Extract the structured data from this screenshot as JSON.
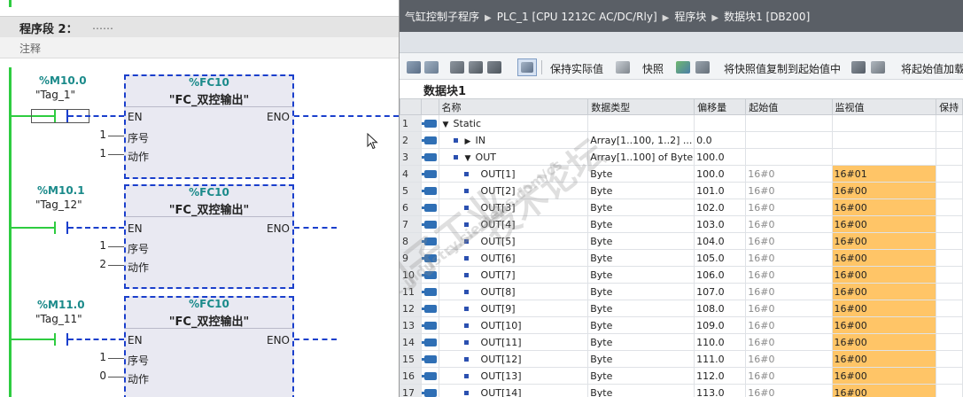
{
  "ladder": {
    "segment_title": "程序段 2：",
    "segment_dots": "……",
    "comment": "注释",
    "networks": [
      {
        "bit_addr": "%M10.0",
        "bit_tag": "\"Tag_1\"",
        "fc_addr": "%FC10",
        "fc_name": "\"FC_双控输出\"",
        "pin_en": "EN",
        "pin_eno": "ENO",
        "pin_seq": "序号",
        "pin_act": "动作",
        "seq_val": "1",
        "act_val": "1"
      },
      {
        "bit_addr": "%M10.1",
        "bit_tag": "\"Tag_12\"",
        "fc_addr": "%FC10",
        "fc_name": "\"FC_双控输出\"",
        "pin_en": "EN",
        "pin_eno": "ENO",
        "pin_seq": "序号",
        "pin_act": "动作",
        "seq_val": "1",
        "act_val": "2"
      },
      {
        "bit_addr": "%M11.0",
        "bit_tag": "\"Tag_11\"",
        "fc_addr": "%FC10",
        "fc_name": "\"FC_双控输出\"",
        "pin_en": "EN",
        "pin_eno": "ENO",
        "pin_seq": "序号",
        "pin_act": "动作",
        "seq_val": "1",
        "act_val": "0"
      }
    ]
  },
  "db_window": {
    "breadcrumb": [
      "气缸控制子程序",
      "PLC_1 [CPU 1212C AC/DC/Rly]",
      "程序块",
      "数据块1 [DB200]"
    ],
    "toolbar": {
      "keep_actual": "保持实际值",
      "snapshot": "快照",
      "copy_snapshot": "将快照值复制到起始值中",
      "load_start": "将起始值加载"
    },
    "block_title": "数据块1",
    "columns": [
      "名称",
      "数据类型",
      "偏移量",
      "起始值",
      "监视值",
      "保持"
    ],
    "rows": [
      {
        "num": "1",
        "name": "Static",
        "level": 0,
        "expand": "down",
        "type": "",
        "offset": "",
        "start": "",
        "monitor": ""
      },
      {
        "num": "2",
        "name": "IN",
        "level": 1,
        "expand": "right",
        "type": "Array[1..100, 1..2] ...",
        "offset": "0.0",
        "start": "",
        "monitor": ""
      },
      {
        "num": "3",
        "name": "OUT",
        "level": 1,
        "expand": "down",
        "type": "Array[1..100] of Byte",
        "offset": "100.0",
        "start": "",
        "monitor": ""
      },
      {
        "num": "4",
        "name": "OUT[1]",
        "level": 2,
        "expand": "",
        "type": "Byte",
        "offset": "100.0",
        "start": "16#0",
        "monitor": "16#01"
      },
      {
        "num": "5",
        "name": "OUT[2]",
        "level": 2,
        "expand": "",
        "type": "Byte",
        "offset": "101.0",
        "start": "16#0",
        "monitor": "16#00"
      },
      {
        "num": "6",
        "name": "OUT[3]",
        "level": 2,
        "expand": "",
        "type": "Byte",
        "offset": "102.0",
        "start": "16#0",
        "monitor": "16#00"
      },
      {
        "num": "7",
        "name": "OUT[4]",
        "level": 2,
        "expand": "",
        "type": "Byte",
        "offset": "103.0",
        "start": "16#0",
        "monitor": "16#00"
      },
      {
        "num": "8",
        "name": "OUT[5]",
        "level": 2,
        "expand": "",
        "type": "Byte",
        "offset": "104.0",
        "start": "16#0",
        "monitor": "16#00"
      },
      {
        "num": "9",
        "name": "OUT[6]",
        "level": 2,
        "expand": "",
        "type": "Byte",
        "offset": "105.0",
        "start": "16#0",
        "monitor": "16#00"
      },
      {
        "num": "10",
        "name": "OUT[7]",
        "level": 2,
        "expand": "",
        "type": "Byte",
        "offset": "106.0",
        "start": "16#0",
        "monitor": "16#00"
      },
      {
        "num": "11",
        "name": "OUT[8]",
        "level": 2,
        "expand": "",
        "type": "Byte",
        "offset": "107.0",
        "start": "16#0",
        "monitor": "16#00"
      },
      {
        "num": "12",
        "name": "OUT[9]",
        "level": 2,
        "expand": "",
        "type": "Byte",
        "offset": "108.0",
        "start": "16#0",
        "monitor": "16#00"
      },
      {
        "num": "13",
        "name": "OUT[10]",
        "level": 2,
        "expand": "",
        "type": "Byte",
        "offset": "109.0",
        "start": "16#0",
        "monitor": "16#00"
      },
      {
        "num": "14",
        "name": "OUT[11]",
        "level": 2,
        "expand": "",
        "type": "Byte",
        "offset": "110.0",
        "start": "16#0",
        "monitor": "16#00"
      },
      {
        "num": "15",
        "name": "OUT[12]",
        "level": 2,
        "expand": "",
        "type": "Byte",
        "offset": "111.0",
        "start": "16#0",
        "monitor": "16#00"
      },
      {
        "num": "16",
        "name": "OUT[13]",
        "level": 2,
        "expand": "",
        "type": "Byte",
        "offset": "112.0",
        "start": "16#0",
        "monitor": "16#00"
      },
      {
        "num": "17",
        "name": "OUT[14]",
        "level": 2,
        "expand": "",
        "type": "Byte",
        "offset": "113.0",
        "start": "16#0",
        "monitor": "16#00"
      }
    ],
    "watermark": [
      "西门子工业",
      "技术论坛",
      "support.industry.siemens.com/cs"
    ]
  },
  "colors": {
    "rail_green": "#2ecc40",
    "wire_blue": "#1a3fcc",
    "monitor_orange": "#ffc567",
    "title_bg": "#5a5f66"
  }
}
